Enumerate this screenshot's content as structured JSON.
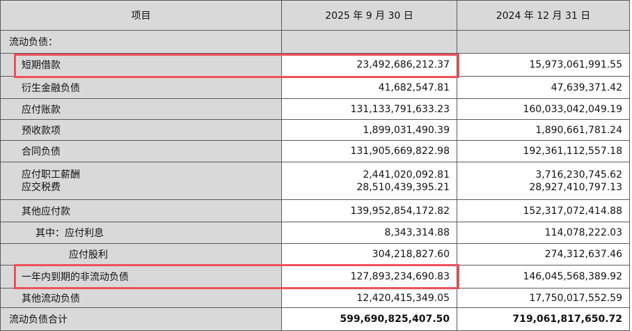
{
  "table": {
    "headers": [
      "项目",
      "2025 年 9 月 30 日",
      "2024 年 12 月 31 日"
    ],
    "section_title": "流动负债：",
    "rows": [
      {
        "label": "短期借款",
        "v2025": "23,492,686,212.37",
        "v2024": "15,973,061,991.55"
      },
      {
        "label": "衍生金融负债",
        "v2025": "41,682,547.81",
        "v2024": "47,639,371.42"
      },
      {
        "label": "应付账款",
        "v2025": "131,133,791,633.23",
        "v2024": "160,033,042,049.19"
      },
      {
        "label": "预收款项",
        "v2025": "1,899,031,490.39",
        "v2024": "1,890,661,781.24"
      },
      {
        "label": "合同负债",
        "v2025": "131,905,669,822.98",
        "v2024": "192,361,112,557.18"
      },
      {
        "label": "应付职工薪酬",
        "v2025": "2,441,020,092.81",
        "v2024": "3,716,230,745.62"
      },
      {
        "label": "应交税费",
        "v2025": "28,510,439,395.21",
        "v2024": "28,927,410,797.13"
      },
      {
        "label": "其他应付款",
        "v2025": "139,952,854,172.82",
        "v2024": "152,317,072,414.88"
      },
      {
        "label": "其中：应付利息",
        "v2025": "8,343,314.88",
        "v2024": "114,078,222.03"
      },
      {
        "label": "应付股利",
        "v2025": "304,218,827.60",
        "v2024": "274,312,637.46"
      },
      {
        "label": "一年内到期的非流动负债",
        "v2025": "127,893,234,690.83",
        "v2024": "146,045,568,389.92"
      },
      {
        "label": "其他流动负债",
        "v2025": "12,420,415,349.05",
        "v2024": "17,750,017,552.59"
      },
      {
        "label": "流动负债合计",
        "v2025": "599,690,825,407.50",
        "v2024": "719,061,817,650.72"
      }
    ]
  },
  "colors": {
    "highlight": "#f0505a",
    "header_fill": "#d9d9d9",
    "grid": "#5a5a5a"
  }
}
